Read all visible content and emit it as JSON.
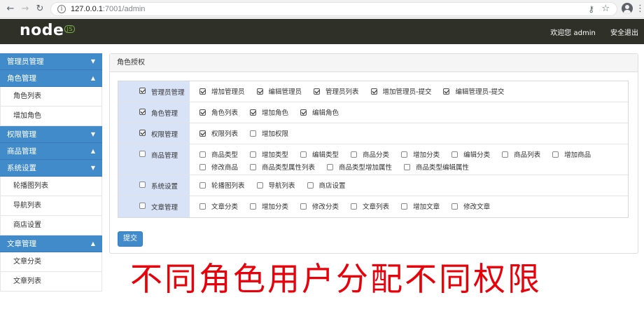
{
  "browser": {
    "url_host": "127.0.0.1",
    "url_rest": ":7001/admin"
  },
  "header": {
    "logo_text": "node",
    "logo_badge": "JS",
    "welcome": "欢迎您 admin",
    "logout": "安全退出"
  },
  "sidebar": {
    "groups": [
      {
        "title": "管理员管理",
        "caret": "▼",
        "items": []
      },
      {
        "title": "角色管理",
        "caret": "▲",
        "items": [
          "角色列表",
          "增加角色"
        ]
      },
      {
        "title": "权限管理",
        "caret": "▼",
        "items": []
      },
      {
        "title": "商品管理",
        "caret": "▲",
        "items": []
      },
      {
        "title": "系统设置",
        "caret": "▼",
        "items": [
          "轮播图列表",
          "导航列表",
          "商店设置"
        ]
      },
      {
        "title": "文章管理",
        "caret": "▲",
        "items": [
          "文章分类",
          "文章列表"
        ]
      }
    ]
  },
  "panel": {
    "title": "角色授权",
    "submit_label": "提交",
    "rows": [
      {
        "name": "管理员管理",
        "checked": true,
        "items": [
          {
            "label": "增加管理员",
            "checked": true
          },
          {
            "label": "编辑管理员",
            "checked": true
          },
          {
            "label": "管理员列表",
            "checked": true
          },
          {
            "label": "增加管理员-提交",
            "checked": true
          },
          {
            "label": "编辑管理员-提交",
            "checked": true
          }
        ]
      },
      {
        "name": "角色管理",
        "checked": true,
        "items": [
          {
            "label": "角色列表",
            "checked": true
          },
          {
            "label": "增加角色",
            "checked": true
          },
          {
            "label": "编辑角色",
            "checked": true
          }
        ]
      },
      {
        "name": "权限管理",
        "checked": true,
        "items": [
          {
            "label": "权限列表",
            "checked": true
          },
          {
            "label": "增加权限",
            "checked": false
          }
        ]
      },
      {
        "name": "商品管理",
        "checked": false,
        "items": [
          {
            "label": "商品类型",
            "checked": false
          },
          {
            "label": "增加类型",
            "checked": false
          },
          {
            "label": "编辑类型",
            "checked": false
          },
          {
            "label": "商品分类",
            "checked": false
          },
          {
            "label": "增加分类",
            "checked": false
          },
          {
            "label": "编辑分类",
            "checked": false
          },
          {
            "label": "商品列表",
            "checked": false
          },
          {
            "label": "增加商品",
            "checked": false
          },
          {
            "label": "修改商品",
            "checked": false
          },
          {
            "label": "商品类型属性列表",
            "checked": false
          },
          {
            "label": "商品类型增加属性",
            "checked": false
          },
          {
            "label": "商品类型编辑属性",
            "checked": false
          }
        ]
      },
      {
        "name": "系统设置",
        "checked": false,
        "items": [
          {
            "label": "轮播图列表",
            "checked": false
          },
          {
            "label": "导航列表",
            "checked": false
          },
          {
            "label": "商店设置",
            "checked": false
          }
        ]
      },
      {
        "name": "文章管理",
        "checked": false,
        "items": [
          {
            "label": "文章分类",
            "checked": false
          },
          {
            "label": "增加分类",
            "checked": false
          },
          {
            "label": "修改分类",
            "checked": false
          },
          {
            "label": "文章列表",
            "checked": false
          },
          {
            "label": "增加文章",
            "checked": false
          },
          {
            "label": "修改文章",
            "checked": false
          }
        ]
      }
    ]
  },
  "caption": "不同角色用户分配不同权限",
  "colors": {
    "primary": "#428bca",
    "header_bg": "#2f3129",
    "category_bg": "#d9e3f7",
    "caption": "#e8000a",
    "node_green": "#7cb342"
  },
  "icons": {
    "back": "arrow-left-icon",
    "forward": "arrow-right-icon",
    "reload": "reload-icon",
    "key": "key-icon",
    "star": "star-icon",
    "account": "account-icon",
    "menu": "kebab-menu-icon"
  }
}
